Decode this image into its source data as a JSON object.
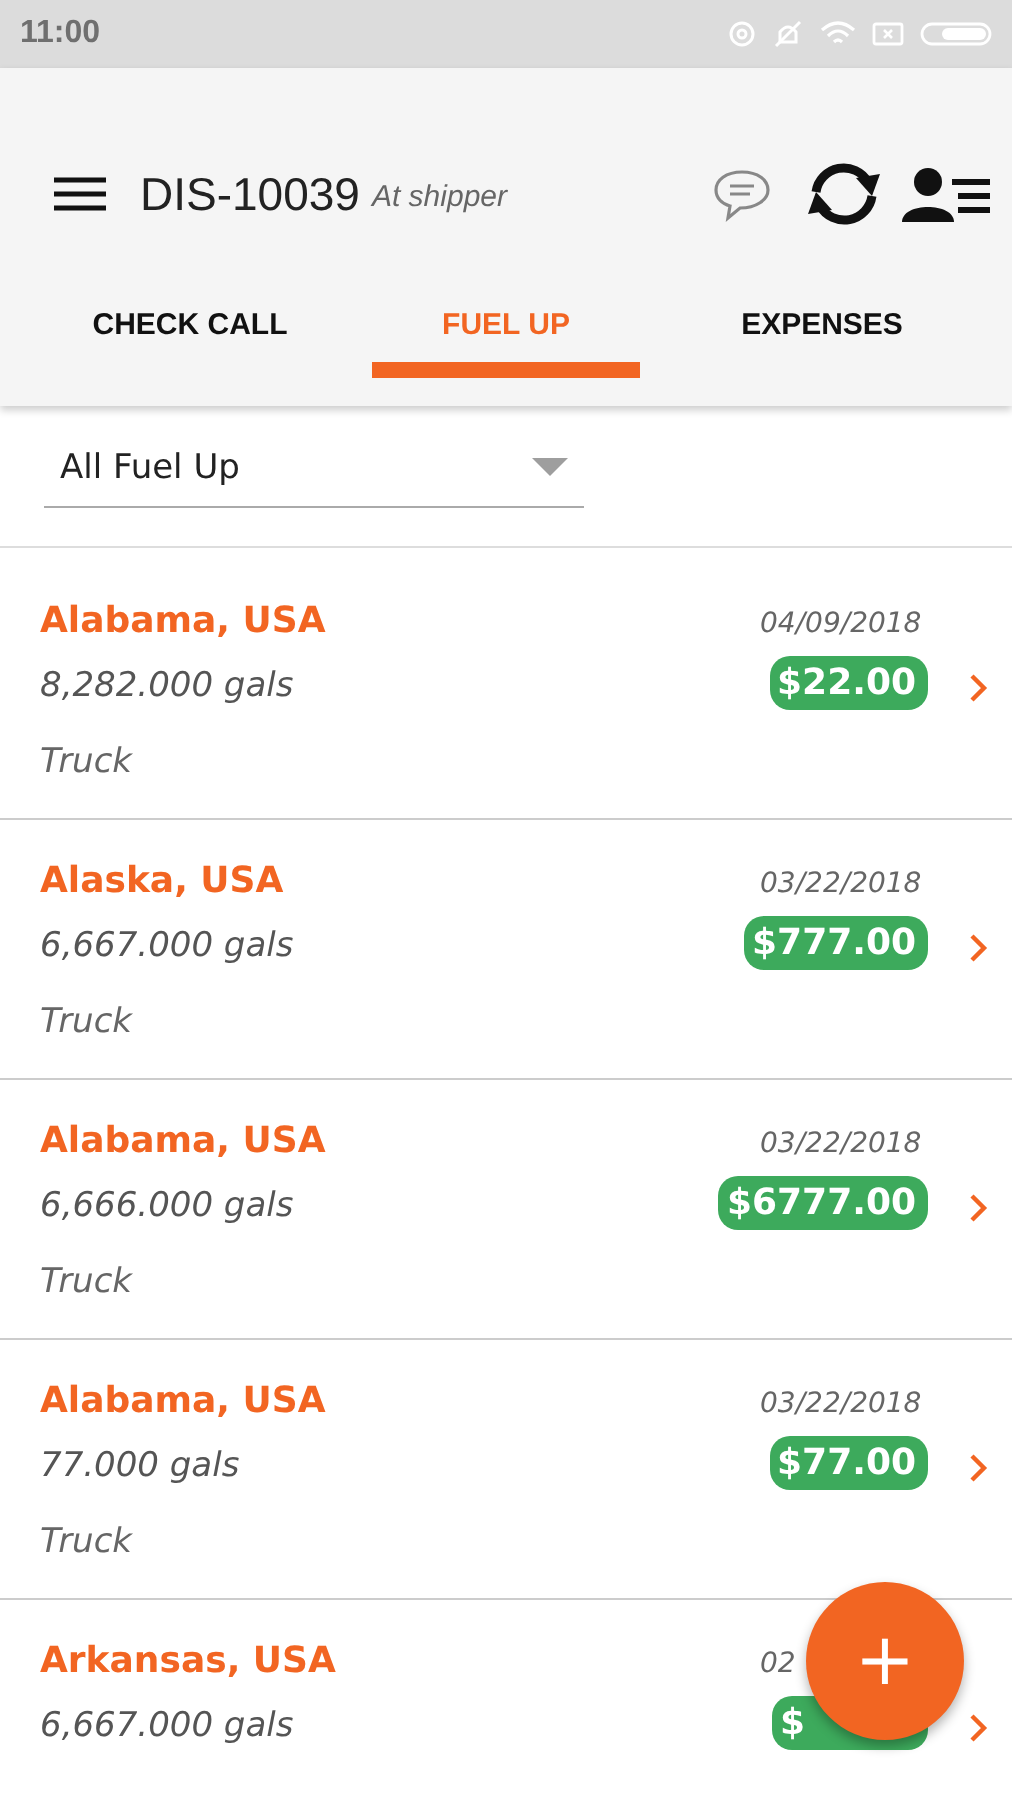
{
  "status_bar": {
    "time": "11:00"
  },
  "header": {
    "trip_id": "DIS-10039",
    "status": "At shipper"
  },
  "tabs": [
    {
      "label": "CHECK CALL",
      "selected": false
    },
    {
      "label": "FUEL UP",
      "selected": true
    },
    {
      "label": "EXPENSES",
      "selected": false
    }
  ],
  "filter": {
    "value": "All Fuel Up"
  },
  "entries": [
    {
      "location": "Alabama, USA",
      "date": "04/09/2018",
      "quantity": "8,282.000 gals",
      "amount": "$22.00",
      "vehicle": "Truck"
    },
    {
      "location": "Alaska, USA",
      "date": "03/22/2018",
      "quantity": "6,667.000 gals",
      "amount": "$777.00",
      "vehicle": "Truck"
    },
    {
      "location": "Alabama, USA",
      "date": "03/22/2018",
      "quantity": "6,666.000 gals",
      "amount": "$6777.00",
      "vehicle": "Truck"
    },
    {
      "location": "Alabama, USA",
      "date": "03/22/2018",
      "quantity": "77.000 gals",
      "amount": "$77.00",
      "vehicle": "Truck"
    },
    {
      "location": "Arkansas, USA",
      "date": "02",
      "quantity": "6,667.000 gals",
      "amount": "$"
    }
  ],
  "fab": {
    "label": "+"
  }
}
